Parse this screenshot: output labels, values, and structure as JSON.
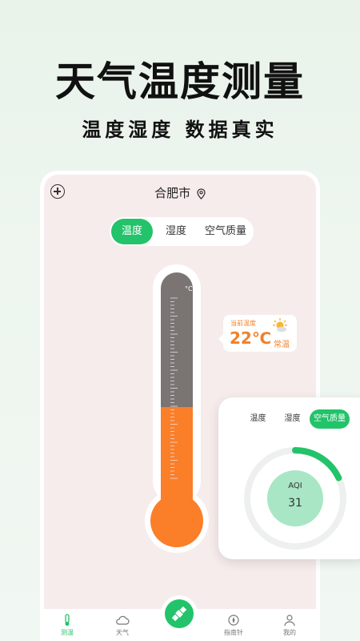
{
  "hero": {
    "title": "天气温度测量",
    "subtitle": "温度湿度 数据真实"
  },
  "header": {
    "city": "合肥市"
  },
  "main_tabs": [
    {
      "label": "温度",
      "active": true
    },
    {
      "label": "湿度",
      "active": false
    },
    {
      "label": "空气质量",
      "active": false
    }
  ],
  "thermometer": {
    "unit": "°C",
    "level_fraction": 0.42
  },
  "reading": {
    "caption": "当前温度",
    "value": "22℃",
    "status": "常温",
    "icon": "sun-cloud-icon"
  },
  "float_card": {
    "tabs": [
      {
        "label": "温度",
        "active": false
      },
      {
        "label": "湿度",
        "active": false
      },
      {
        "label": "空气质量",
        "active": true
      }
    ],
    "aqi_label": "AQI",
    "aqi_value": "31",
    "gauge_fraction": 0.18
  },
  "tabbar": [
    {
      "label": "测温",
      "icon": "thermometer-icon",
      "active": true
    },
    {
      "label": "天气",
      "icon": "cloud-icon",
      "active": false
    },
    {
      "label": "",
      "icon": "satellite-icon",
      "active": false
    },
    {
      "label": "指南针",
      "icon": "compass-icon",
      "active": false
    },
    {
      "label": "我的",
      "icon": "user-icon",
      "active": false
    }
  ],
  "colors": {
    "accent": "#22c36a",
    "mercury": "#fb7e29",
    "tube": "#7a7473",
    "reading": "#f0802a"
  }
}
